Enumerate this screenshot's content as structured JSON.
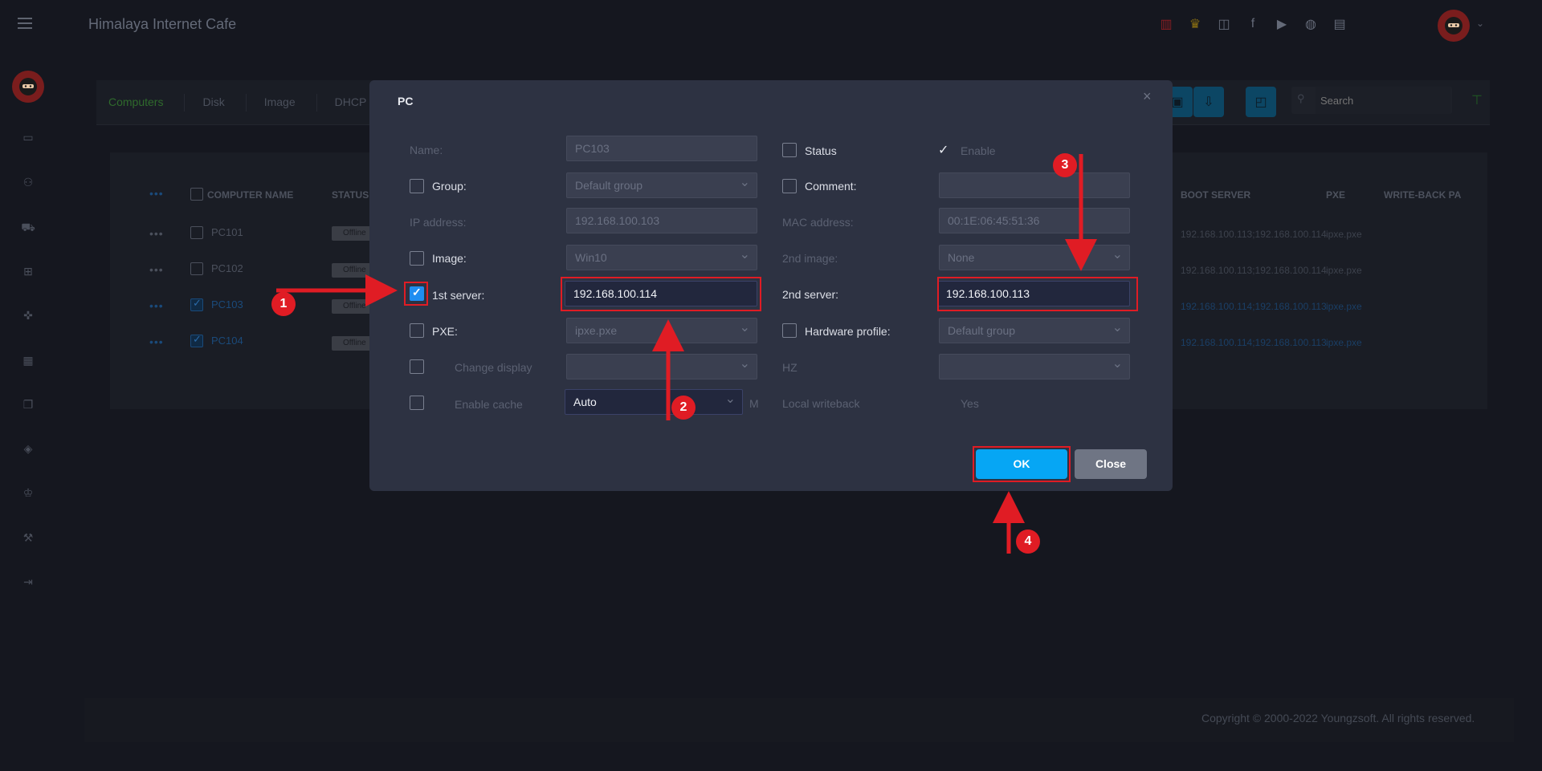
{
  "app": {
    "title": "Himalaya Internet Cafe",
    "copyright": "Copyright © 2000-2022 Youngzsoft. All rights reserved."
  },
  "tabs": [
    {
      "label": "Computers"
    },
    {
      "label": "Disk"
    },
    {
      "label": "Image"
    },
    {
      "label": "DHCP"
    }
  ],
  "search": {
    "placeholder": "Search"
  },
  "table": {
    "headers": {
      "computer_name": "COMPUTER NAME",
      "status": "STATUS",
      "boot_server": "BOOT SERVER",
      "pxe": "PXE",
      "write_back": "WRITE-BACK PA"
    },
    "rows": [
      {
        "name": "PC101",
        "status": "Offline",
        "boot_server": "192.168.100.113;192.168.100.114",
        "pxe": "ipxe.pxe"
      },
      {
        "name": "PC102",
        "status": "Offline",
        "boot_server": "192.168.100.113;192.168.100.114",
        "pxe": "ipxe.pxe"
      },
      {
        "name": "PC103",
        "status": "Offline",
        "boot_server": "192.168.100.114;192.168.100.113",
        "pxe": "ipxe.pxe"
      },
      {
        "name": "PC104",
        "status": "Offline",
        "boot_server": "192.168.100.114;192.168.100.113",
        "pxe": "ipxe.pxe"
      }
    ]
  },
  "dialog": {
    "title": "PC",
    "close_glyph": "×",
    "labels": {
      "name": "Name:",
      "group": "Group:",
      "ip": "IP address:",
      "image": "Image:",
      "first_server": "1st server:",
      "pxe": "PXE:",
      "change_display": "Change display",
      "enable_cache": "Enable cache",
      "status": "Status",
      "enable": "Enable",
      "comment": "Comment:",
      "mac": "MAC address:",
      "second_image": "2nd image:",
      "second_server": "2nd server:",
      "hardware_profile": "Hardware profile:",
      "hz": "HZ",
      "local_writeback": "Local writeback",
      "yes": "Yes",
      "cache_unit": "M"
    },
    "values": {
      "name": "PC103",
      "group": "Default group",
      "ip": "192.168.100.103",
      "image": "Win10",
      "first_server": "192.168.100.114",
      "pxe": "ipxe.pxe",
      "change_display": "",
      "enable_cache": "Auto",
      "comment": "",
      "mac": "00:1E:06:45:51:36",
      "second_image": "None",
      "second_server": "192.168.100.113",
      "hardware_profile": "Default group",
      "hz": ""
    },
    "ok_label": "OK",
    "close_label": "Close"
  },
  "annotations": {
    "step1": "1",
    "step2": "2",
    "step3": "3",
    "step4": "4"
  },
  "colors": {
    "accent": "#06a6f4",
    "annotation": "#e01c24",
    "dialog_bg": "#2d3242",
    "page_bg": "#15171f"
  }
}
